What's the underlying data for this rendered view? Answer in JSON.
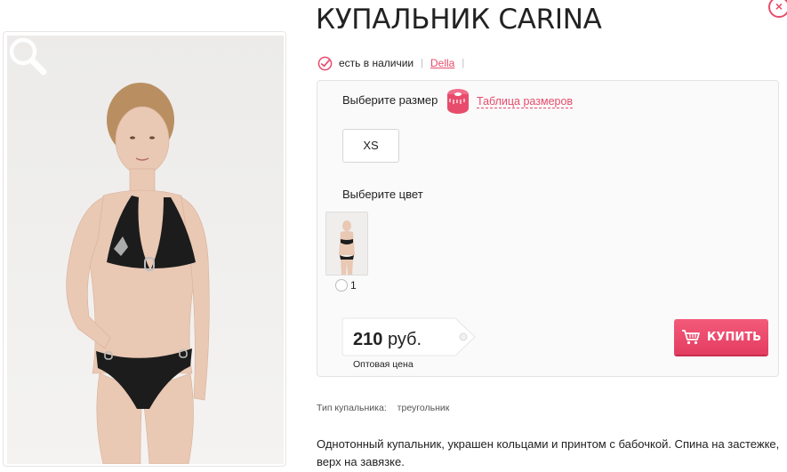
{
  "product": {
    "title": "КУПАЛЬНИК CARINA",
    "availability": "есть в наличии",
    "brand": "Della",
    "close_symbol": "×"
  },
  "options": {
    "size_label": "Выберите размер",
    "size_table_link": "Таблица размеров",
    "sizes": [
      "XS"
    ],
    "color_label": "Выберите цвет",
    "colors": [
      {
        "label": "1"
      }
    ]
  },
  "price": {
    "amount": "210",
    "currency": "руб.",
    "caption": "Оптовая цена"
  },
  "buy_button": {
    "label": "КУПИТЬ"
  },
  "attributes": [
    {
      "name": "Тип купальника:",
      "value": "треугольник"
    }
  ],
  "description": "Однотонный купальник, украшен кольцами и принтом с бабочкой. Спина на застежке, верх на завязке.",
  "colors": {
    "accent": "#e84c6c",
    "swimsuit": "#1c1c1c",
    "photo_background": "#efeeec"
  }
}
